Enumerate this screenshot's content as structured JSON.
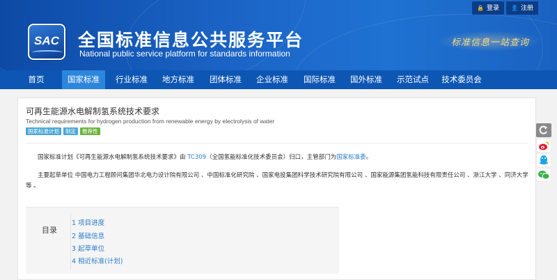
{
  "header": {
    "logo_text": "SAC",
    "title": "全国标准信息公共服务平台",
    "subtitle": "National public service platform  for standards information",
    "slogan": "标准信息一站查询",
    "login_label": "登录",
    "register_label": "注册"
  },
  "nav": {
    "items": [
      {
        "label": "首页"
      },
      {
        "label": "国家标准"
      },
      {
        "label": "行业标准"
      },
      {
        "label": "地方标准"
      },
      {
        "label": "团体标准"
      },
      {
        "label": "企业标准"
      },
      {
        "label": "国际标准"
      },
      {
        "label": "国外标准"
      },
      {
        "label": "示范试点"
      },
      {
        "label": "技术委员会"
      }
    ],
    "active": "国家标准"
  },
  "standard": {
    "title": "可再生能源水电解制氢系统技术要求",
    "english_title": "Technical requirements for hydrogen production from renewable energy by electrolysis of water",
    "badges": [
      "国家标准计划",
      "制定",
      "推荐性"
    ],
    "plan_text_prefix": "国家标准计划《可再生能源水电解制氢系统技术要求》由 ",
    "tc_link": "TC309",
    "plan_text_middle": "（全国氢能标准化技术委员会）归口，主管部门为",
    "dept_link": "国家标准委",
    "plan_text_suffix": "。",
    "drafters_text": "主要起草单位 中国电力工程顾问集团华北电力设计院有限公司 、中国标准化研究院 、国家电投集团科学技术研究院有限公司 、国家能源集团氢能科技有限责任公司 、浙江大学 、同济大学等 。"
  },
  "toc": {
    "label": "目录",
    "items": [
      {
        "label": "1  项目进度"
      },
      {
        "label": "2  基础信息"
      },
      {
        "label": "3  起草单位"
      },
      {
        "label": "4  相近标准(计划)"
      }
    ]
  },
  "share": {
    "icons": [
      "back-icon",
      "weibo-icon",
      "qq-icon",
      "wechat-icon"
    ]
  }
}
